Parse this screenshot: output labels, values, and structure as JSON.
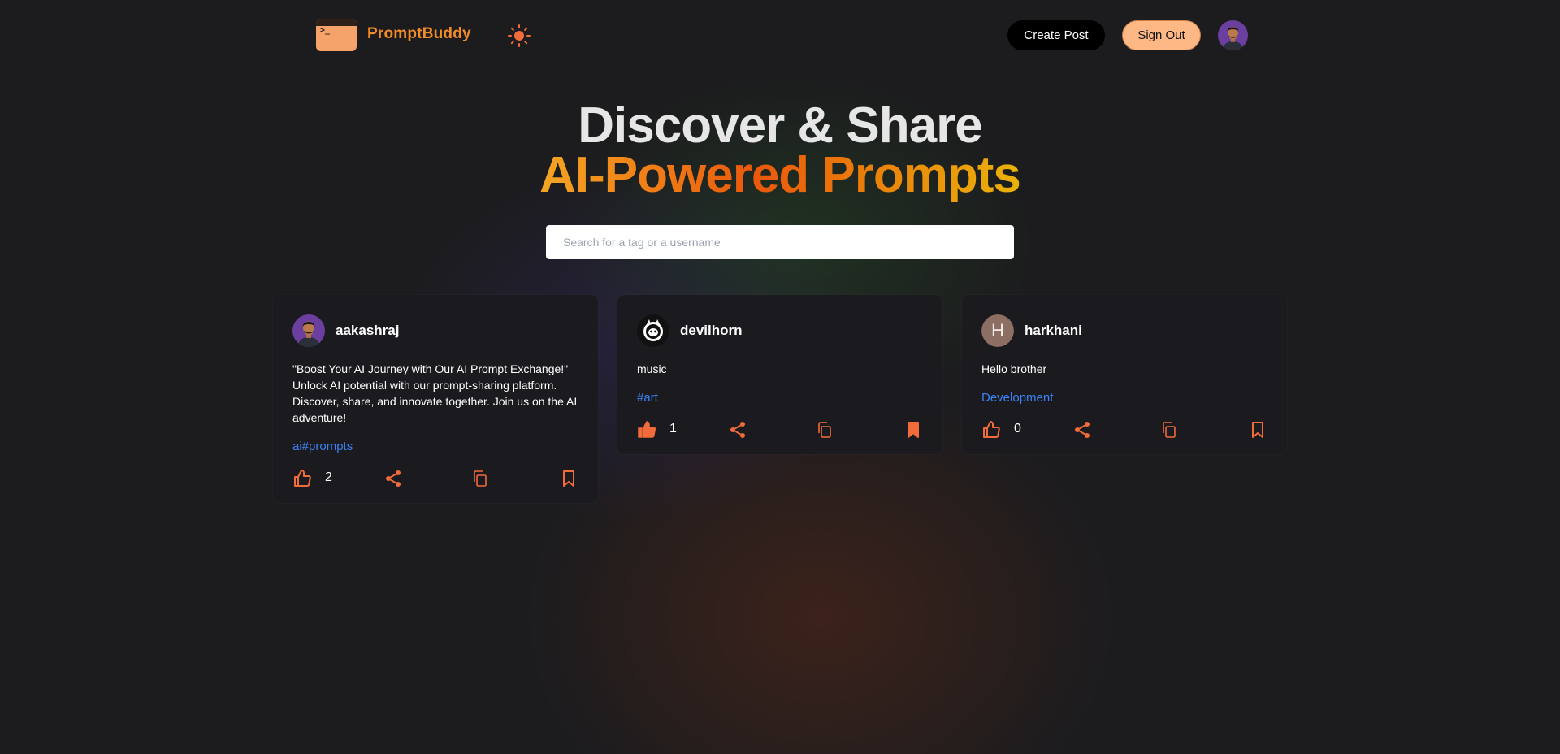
{
  "app": {
    "brand": "PromptBuddy",
    "logo_prompt": ">_"
  },
  "header": {
    "create_label": "Create Post",
    "signout_label": "Sign Out"
  },
  "hero": {
    "line1": "Discover & Share",
    "line2": "AI-Powered Prompts"
  },
  "search": {
    "placeholder": "Search for a tag or a username",
    "value": ""
  },
  "colors": {
    "accent": "#f28c28",
    "action": "#f26b3a",
    "tag": "#3b82f6",
    "card": "#1b1a1f"
  },
  "posts": [
    {
      "username": "aakashraj",
      "avatar": "photo",
      "text": "\"Boost Your AI Journey with Our AI Prompt Exchange!\" Unlock AI potential with our prompt-sharing platform. Discover, share, and innovate together. Join us on the AI adventure!",
      "tag": "ai#prompts",
      "likes": "2",
      "liked": false,
      "bookmarked": false
    },
    {
      "username": "devilhorn",
      "avatar": "logo",
      "text": "music",
      "tag": "#art",
      "likes": "1",
      "liked": true,
      "bookmarked": true
    },
    {
      "username": "harkhani",
      "avatar": "letter",
      "avatar_letter": "H",
      "text": "Hello brother",
      "tag": "Development",
      "likes": "0",
      "liked": false,
      "bookmarked": false
    }
  ]
}
